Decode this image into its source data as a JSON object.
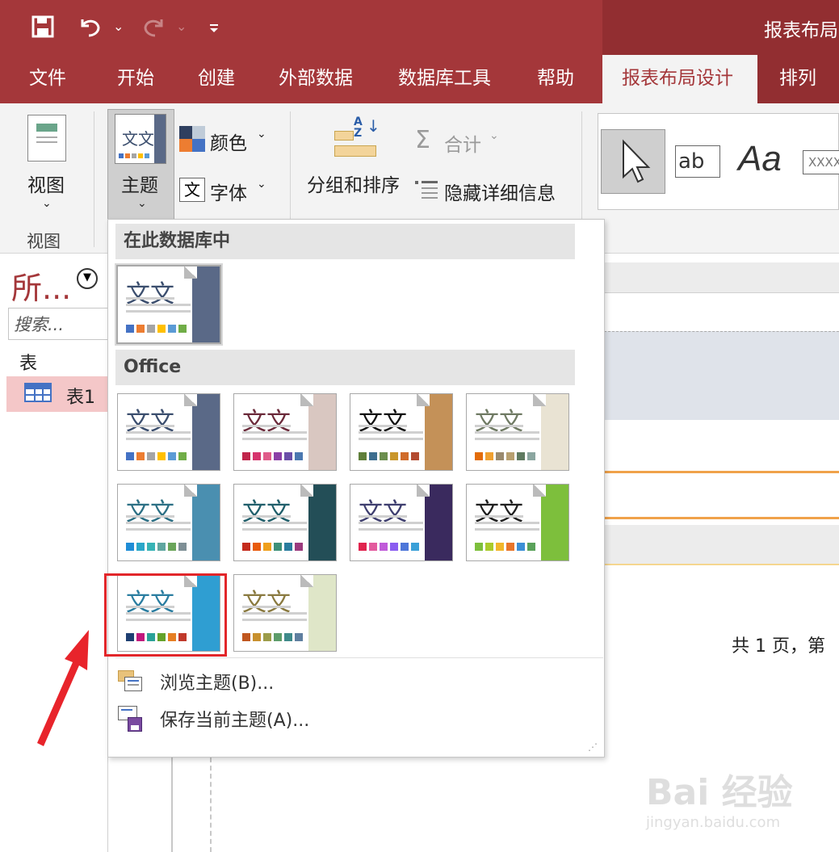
{
  "title": "报表布局",
  "tabs": [
    "文件",
    "开始",
    "创建",
    "外部数据",
    "数据库工具",
    "帮助",
    "报表布局设计",
    "排列"
  ],
  "ribbon": {
    "view_label": "视图",
    "view_group": "视图",
    "theme_label": "主题",
    "colors_label": "颜色",
    "fonts_label": "字体",
    "group_sort_label": "分组和排序",
    "totals_label": "合计",
    "hide_details_label": "隐藏详细信息",
    "control_ab": "ab",
    "control_aa": "Aa",
    "control_xxxx": "XXXX",
    "theme_icon_text": "文文"
  },
  "nav": {
    "title": "所...",
    "search_placeholder": "搜索...",
    "section": "表",
    "table_item": "表1"
  },
  "report": {
    "footer_text": "共 1 页，第"
  },
  "dropdown": {
    "section_db": "在此数据库中",
    "section_office": "Office",
    "themes_db": [
      {
        "text": "文文",
        "text_color": "#3b4e6e",
        "strip": "#5a6987",
        "swatches": [
          "#4472c4",
          "#ed7d31",
          "#a5a5a5",
          "#ffc000",
          "#5b9bd5",
          "#70ad47"
        ]
      }
    ],
    "themes_office": [
      {
        "text": "文文",
        "text_color": "#3b4e6e",
        "strip": "#5a6987",
        "swatches": [
          "#4472c4",
          "#ed7d31",
          "#a5a5a5",
          "#ffc000",
          "#5b9bd5",
          "#70ad47"
        ]
      },
      {
        "text": "文文",
        "text_color": "#6b2a3a",
        "strip": "#d9c7c1",
        "swatches": [
          "#c0254b",
          "#d6336c",
          "#e05c8a",
          "#8b3fa6",
          "#6b4fa8",
          "#4b78b0"
        ]
      },
      {
        "text": "文文",
        "text_color": "#111111",
        "strip": "#c49158",
        "swatches": [
          "#5f7f3a",
          "#3d6e8f",
          "#6b8e4e",
          "#c9962a",
          "#d06b2a",
          "#b34a2f"
        ]
      },
      {
        "text": "文文",
        "text_color": "#6f7a63",
        "strip": "#e9e3d3",
        "swatches": [
          "#e36c0a",
          "#f0a030",
          "#9a8a6e",
          "#b8a070",
          "#5f7a60",
          "#8ba6a0"
        ]
      },
      {
        "text": "文文",
        "text_color": "#2b6f84",
        "strip": "#4a8fb0",
        "swatches": [
          "#1f8dd6",
          "#2aa7c9",
          "#36b3b5",
          "#5fa6a0",
          "#6aa55a",
          "#7e8f96"
        ]
      },
      {
        "text": "文文",
        "text_color": "#1f5e6a",
        "strip": "#234e57",
        "swatches": [
          "#c42b1c",
          "#e85a0c",
          "#ef9f1c",
          "#3d8f78",
          "#2a7c9e",
          "#9b3a7e"
        ]
      },
      {
        "text": "文文",
        "text_color": "#3d3d6e",
        "strip": "#3a2a5e",
        "swatches": [
          "#e0234e",
          "#e35a9e",
          "#c05bd9",
          "#8a5cf0",
          "#4d76d9",
          "#3aa0d8"
        ]
      },
      {
        "text": "文文",
        "text_color": "#1e1e1e",
        "strip": "#7dbf3c",
        "swatches": [
          "#7dbf3c",
          "#aacb2b",
          "#f2b62b",
          "#e8752a",
          "#3c8fd6",
          "#5aa25a"
        ]
      },
      {
        "text": "文文",
        "text_color": "#2a7da0",
        "strip": "#2f9ed2",
        "swatches": [
          "#1e3f72",
          "#c2187d",
          "#2aa198",
          "#64a22a",
          "#e67e22",
          "#c0392b"
        ]
      },
      {
        "text": "文文",
        "text_color": "#8a7a40",
        "strip": "#dfe6c8",
        "swatches": [
          "#c0571f",
          "#c8902e",
          "#9c9c4a",
          "#5d9c6a",
          "#3f8a8a",
          "#5f7f9f"
        ]
      }
    ],
    "browse_label": "浏览主题(B)...",
    "save_label": "保存当前主题(A)..."
  },
  "watermark": {
    "main": "Bai 经验",
    "sub": "jingyan.baidu.com"
  }
}
